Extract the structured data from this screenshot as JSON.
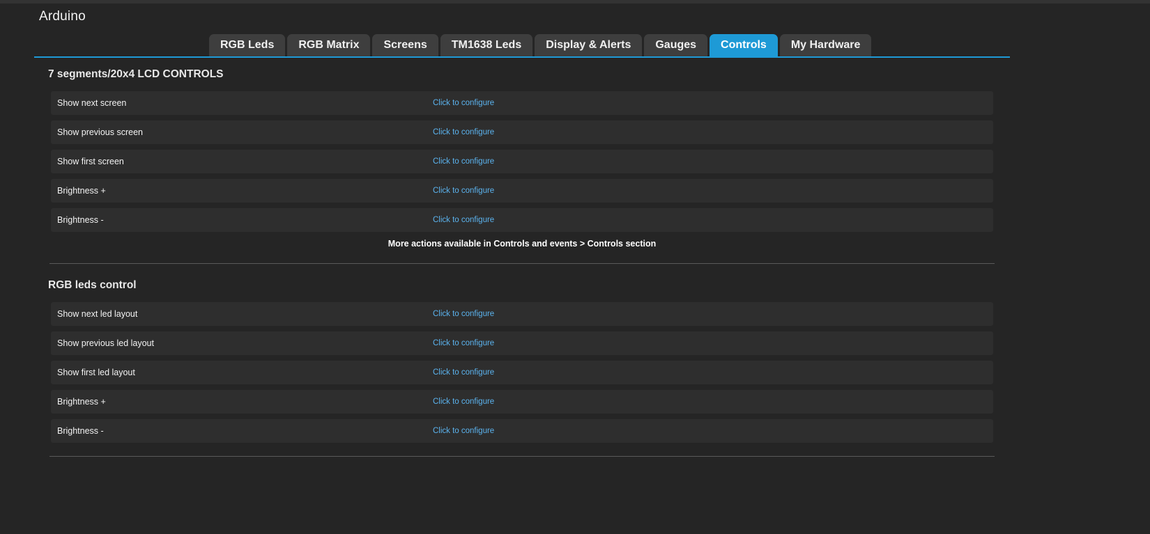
{
  "app": {
    "title": "Arduino"
  },
  "tabs": [
    {
      "label": "RGB Leds",
      "active": false
    },
    {
      "label": "RGB Matrix",
      "active": false
    },
    {
      "label": "Screens",
      "active": false
    },
    {
      "label": "TM1638 Leds",
      "active": false
    },
    {
      "label": "Display & Alerts",
      "active": false
    },
    {
      "label": "Gauges",
      "active": false
    },
    {
      "label": "Controls",
      "active": true
    },
    {
      "label": "My Hardware",
      "active": false
    }
  ],
  "sections": [
    {
      "title": "7 segments/20x4 LCD CONTROLS",
      "rows": [
        {
          "label": "Show next screen",
          "link": "Click to configure"
        },
        {
          "label": "Show previous screen",
          "link": "Click to configure"
        },
        {
          "label": "Show first screen",
          "link": "Click to configure"
        },
        {
          "label": "Brightness +",
          "link": "Click to configure"
        },
        {
          "label": "Brightness -",
          "link": "Click to configure"
        }
      ],
      "note": "More actions available in Controls and events > Controls section"
    },
    {
      "title": "RGB leds control",
      "rows": [
        {
          "label": "Show next led layout",
          "link": "Click to configure"
        },
        {
          "label": "Show previous led layout",
          "link": "Click to configure"
        },
        {
          "label": "Show first led layout",
          "link": "Click to configure"
        },
        {
          "label": "Brightness +",
          "link": "Click to configure"
        },
        {
          "label": "Brightness -",
          "link": "Click to configure"
        }
      ]
    }
  ],
  "colors": {
    "background": "#252525",
    "accent": "#1e9ad6",
    "tab": "#3e3e3e",
    "row": "#2e2e2e",
    "link": "#5bb3ee"
  }
}
